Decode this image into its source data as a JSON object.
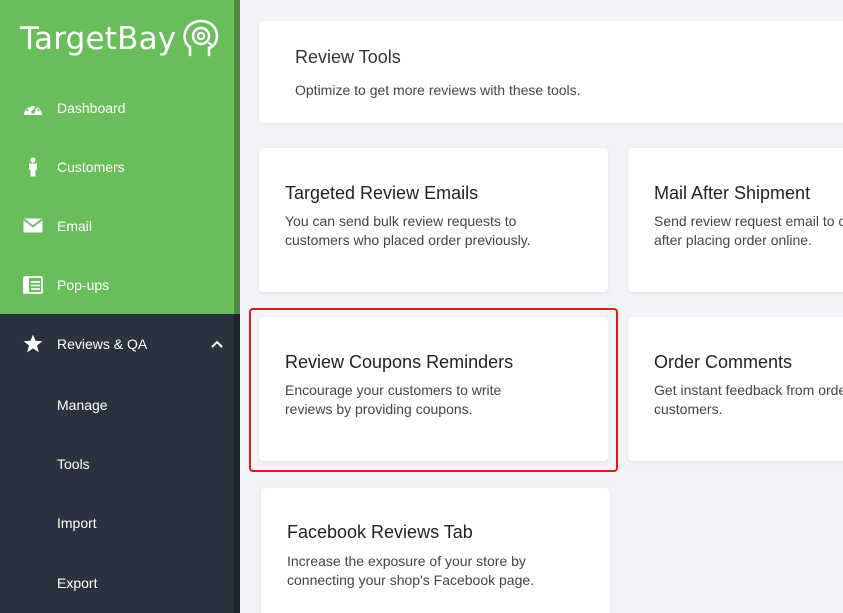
{
  "brand": {
    "name": "TargetBay"
  },
  "sidebar": {
    "items": [
      {
        "label": "Dashboard",
        "icon": "dashboard-icon"
      },
      {
        "label": "Customers",
        "icon": "person-icon"
      },
      {
        "label": "Email",
        "icon": "envelope-icon"
      },
      {
        "label": "Pop-ups",
        "icon": "popup-icon"
      },
      {
        "label": "Reviews & QA",
        "icon": "star-icon",
        "expanded": true
      }
    ],
    "sub_items": [
      {
        "label": "Manage"
      },
      {
        "label": "Tools"
      },
      {
        "label": "Import"
      },
      {
        "label": "Export"
      }
    ]
  },
  "header": {
    "title": "Review Tools",
    "subtitle": "Optimize to get more reviews with these tools."
  },
  "tools": [
    {
      "title": "Targeted Review Emails",
      "desc_line1": "You can send bulk review requests to",
      "desc_line2": "customers who placed order previously."
    },
    {
      "title": "Mail After Shipment",
      "desc_line1": "Send review request email to c",
      "desc_line2": "after placing order online."
    },
    {
      "title": "Review Coupons Reminders",
      "desc_line1": "Encourage your customers to write",
      "desc_line2": "reviews by providing coupons."
    },
    {
      "title": "Order Comments",
      "desc_line1": "Get instant feedback from orde",
      "desc_line2": "customers."
    },
    {
      "title": "Facebook Reviews Tab",
      "desc_line1": "Increase the exposure of your store by",
      "desc_line2": "connecting your shop's Facebook page."
    }
  ],
  "colors": {
    "sidebar_green": "#69bd5b",
    "sidebar_dark": "#2c3140",
    "highlight_red": "#e01b1b",
    "background": "#f2f3f7"
  }
}
